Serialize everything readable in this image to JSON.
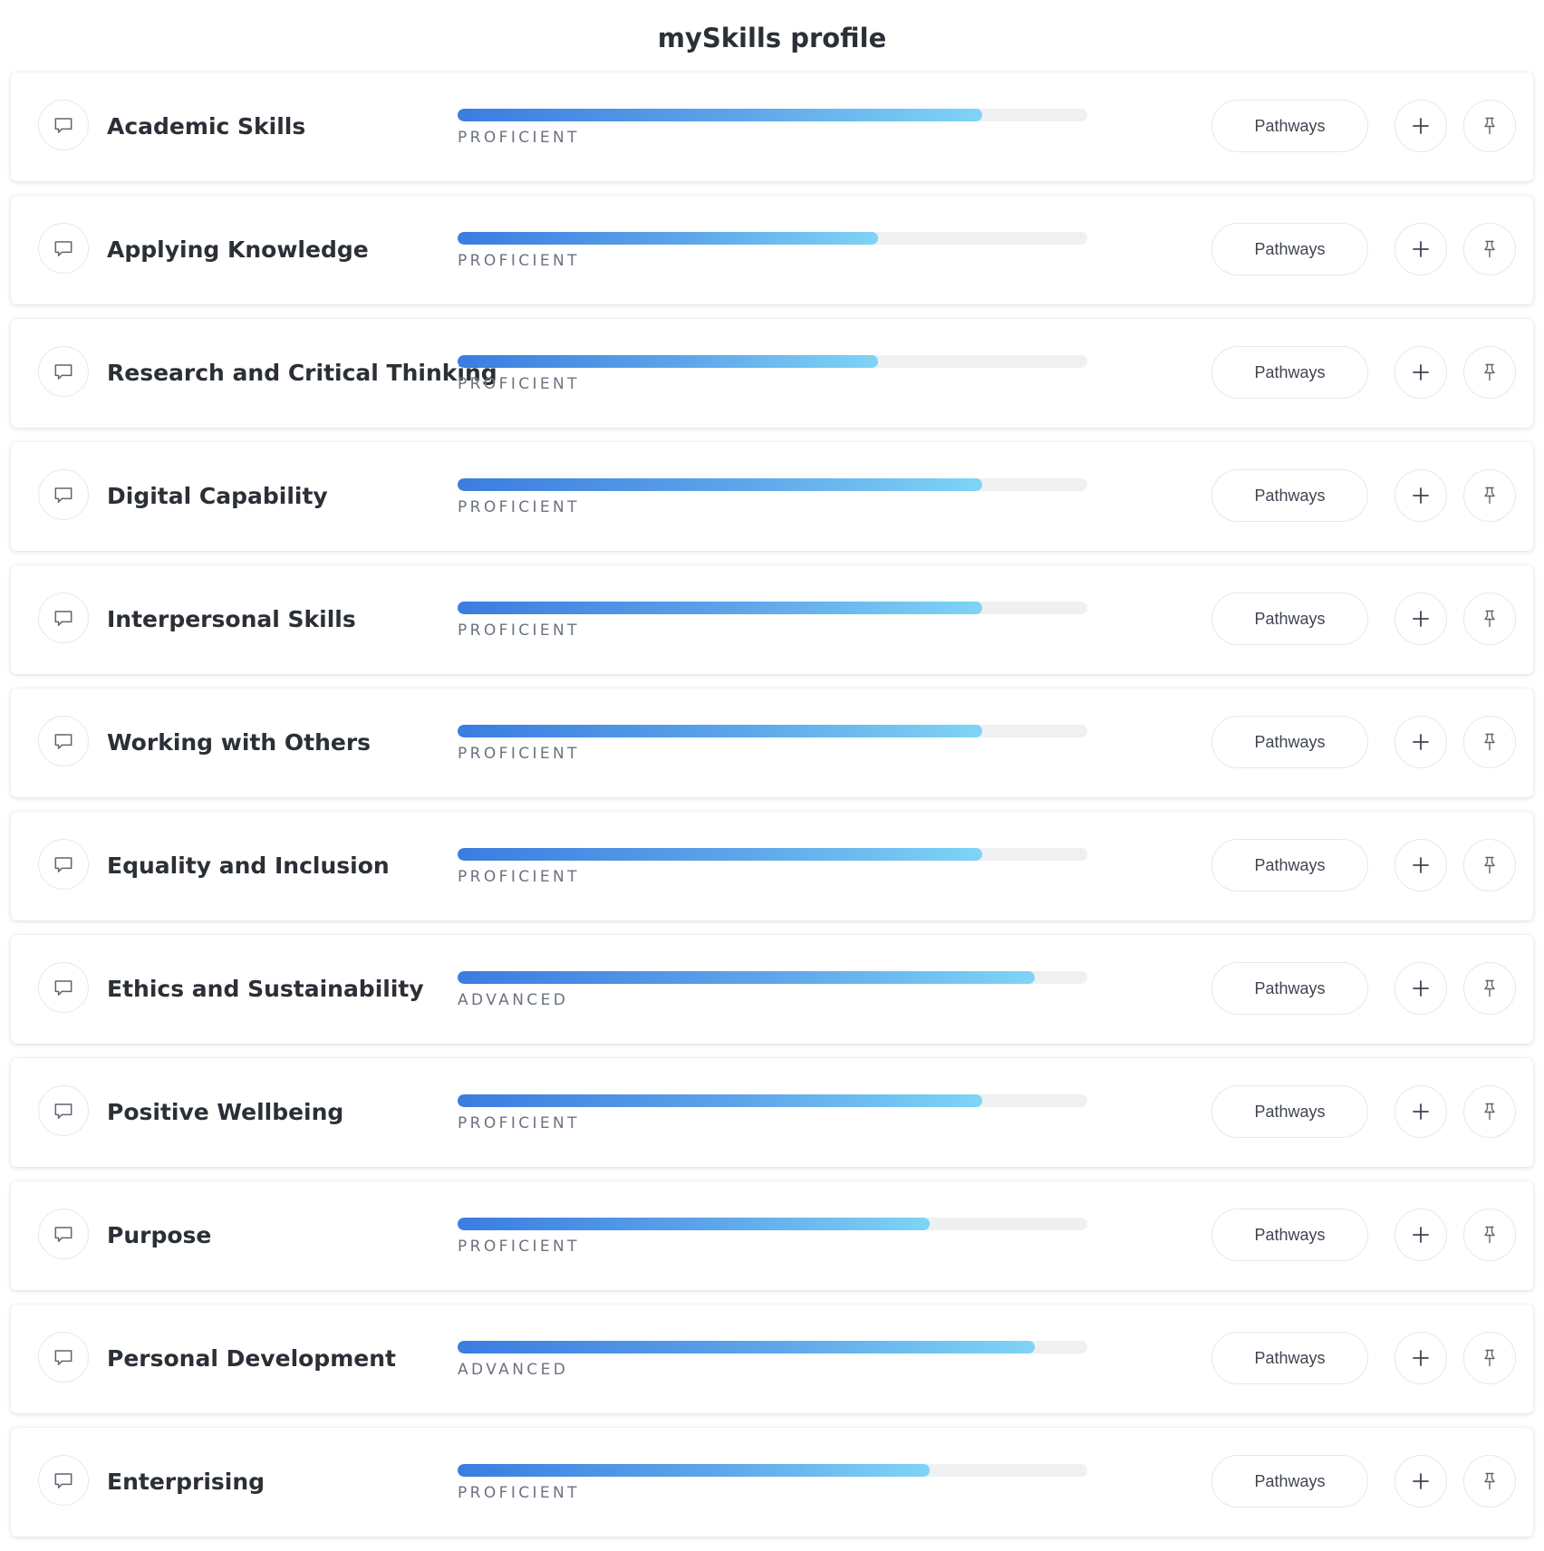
{
  "page": {
    "title": "mySkills profile"
  },
  "icons": {
    "comment": "comment-icon",
    "add": "plus-icon",
    "pin": "pin-icon"
  },
  "colors": {
    "bar_start": "#3a7de0",
    "bar_end": "#7fd4f6",
    "track": "#eff0f2",
    "text": "#2b2f36",
    "muted": "#6b7280"
  },
  "skills": [
    {
      "name": "Academic Skills",
      "level": "PROFICIENT",
      "progress": 0.833,
      "pathways_label": "Pathways"
    },
    {
      "name": "Applying Knowledge",
      "level": "PROFICIENT",
      "progress": 0.667,
      "pathways_label": "Pathways"
    },
    {
      "name": "Research and Critical Thinking",
      "level": "PROFICIENT",
      "progress": 0.667,
      "pathways_label": "Pathways"
    },
    {
      "name": "Digital Capability",
      "level": "PROFICIENT",
      "progress": 0.833,
      "pathways_label": "Pathways"
    },
    {
      "name": "Interpersonal Skills",
      "level": "PROFICIENT",
      "progress": 0.833,
      "pathways_label": "Pathways"
    },
    {
      "name": "Working with Others",
      "level": "PROFICIENT",
      "progress": 0.833,
      "pathways_label": "Pathways"
    },
    {
      "name": "Equality and Inclusion",
      "level": "PROFICIENT",
      "progress": 0.833,
      "pathways_label": "Pathways"
    },
    {
      "name": "Ethics and Sustainability",
      "level": "ADVANCED",
      "progress": 0.917,
      "pathways_label": "Pathways"
    },
    {
      "name": "Positive Wellbeing",
      "level": "PROFICIENT",
      "progress": 0.833,
      "pathways_label": "Pathways"
    },
    {
      "name": "Purpose",
      "level": "PROFICIENT",
      "progress": 0.75,
      "pathways_label": "Pathways"
    },
    {
      "name": "Personal Development",
      "level": "ADVANCED",
      "progress": 0.917,
      "pathways_label": "Pathways"
    },
    {
      "name": "Enterprising",
      "level": "PROFICIENT",
      "progress": 0.75,
      "pathways_label": "Pathways"
    }
  ]
}
